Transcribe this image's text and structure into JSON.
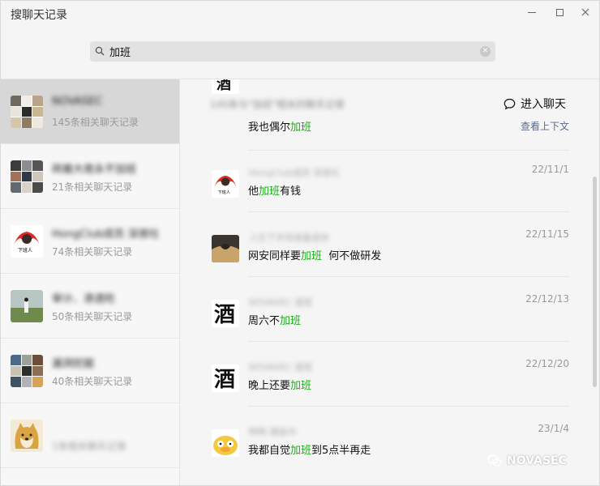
{
  "window": {
    "title": "搜聊天记录",
    "minimize_label": "—",
    "maximize_label": "□",
    "close_label": "✕"
  },
  "search": {
    "value": "加班",
    "icon": "search-icon",
    "clear_icon": "clear-icon"
  },
  "conversations": [
    {
      "name": "NOVASEC",
      "count": "145条相关聊天记录",
      "selected": true
    },
    {
      "name": "砖搬大佬永不加班",
      "count": "21条相关聊天记录"
    },
    {
      "name": "HongClub成员 深夜吐",
      "count": "74条相关聊天记录"
    },
    {
      "name": "审计、渗透吃",
      "count": "50条相关聊天记录"
    },
    {
      "name": "漏洞挖掘",
      "count": "40条相关聊天记录"
    },
    {
      "name": "",
      "count": "1条相关聊天记录",
      "count_blurred": true
    }
  ],
  "detail": {
    "header": "145条与\"加班\"相关的聊天记录",
    "enter_chat": "进入聊天",
    "context_link": "查看上下文",
    "messages": [
      {
        "sender": "",
        "date": "",
        "pre": "我也偶尔",
        "hl": "加班",
        "post": ""
      },
      {
        "sender": "HongClub成员 深夜吐",
        "date": "22/11/1",
        "pre": "他",
        "hl": "加班",
        "post": "有钱"
      },
      {
        "sender": "人生下半场准备退休",
        "date": "22/11/15",
        "pre": "网安同样要",
        "hl": "加班",
        "post": "  何不做研发"
      },
      {
        "sender": "NOVASEC 酒哥",
        "date": "22/12/13",
        "pre": "周六不",
        "hl": "加班",
        "post": ""
      },
      {
        "sender": "NOVASEC 酒哥",
        "date": "22/12/20",
        "pre": "晚上还要",
        "hl": "加班",
        "post": ""
      },
      {
        "sender": "鸭鸭 摸鱼中",
        "date": "23/1/4",
        "pre": "我都自觉",
        "hl": "加班",
        "post": "到5点半再走"
      }
    ]
  },
  "watermark": "NOVASEC",
  "colors": {
    "highlight": "#1aad19",
    "link": "#5b6b8c",
    "selected_bg": "#d7d7d7"
  }
}
